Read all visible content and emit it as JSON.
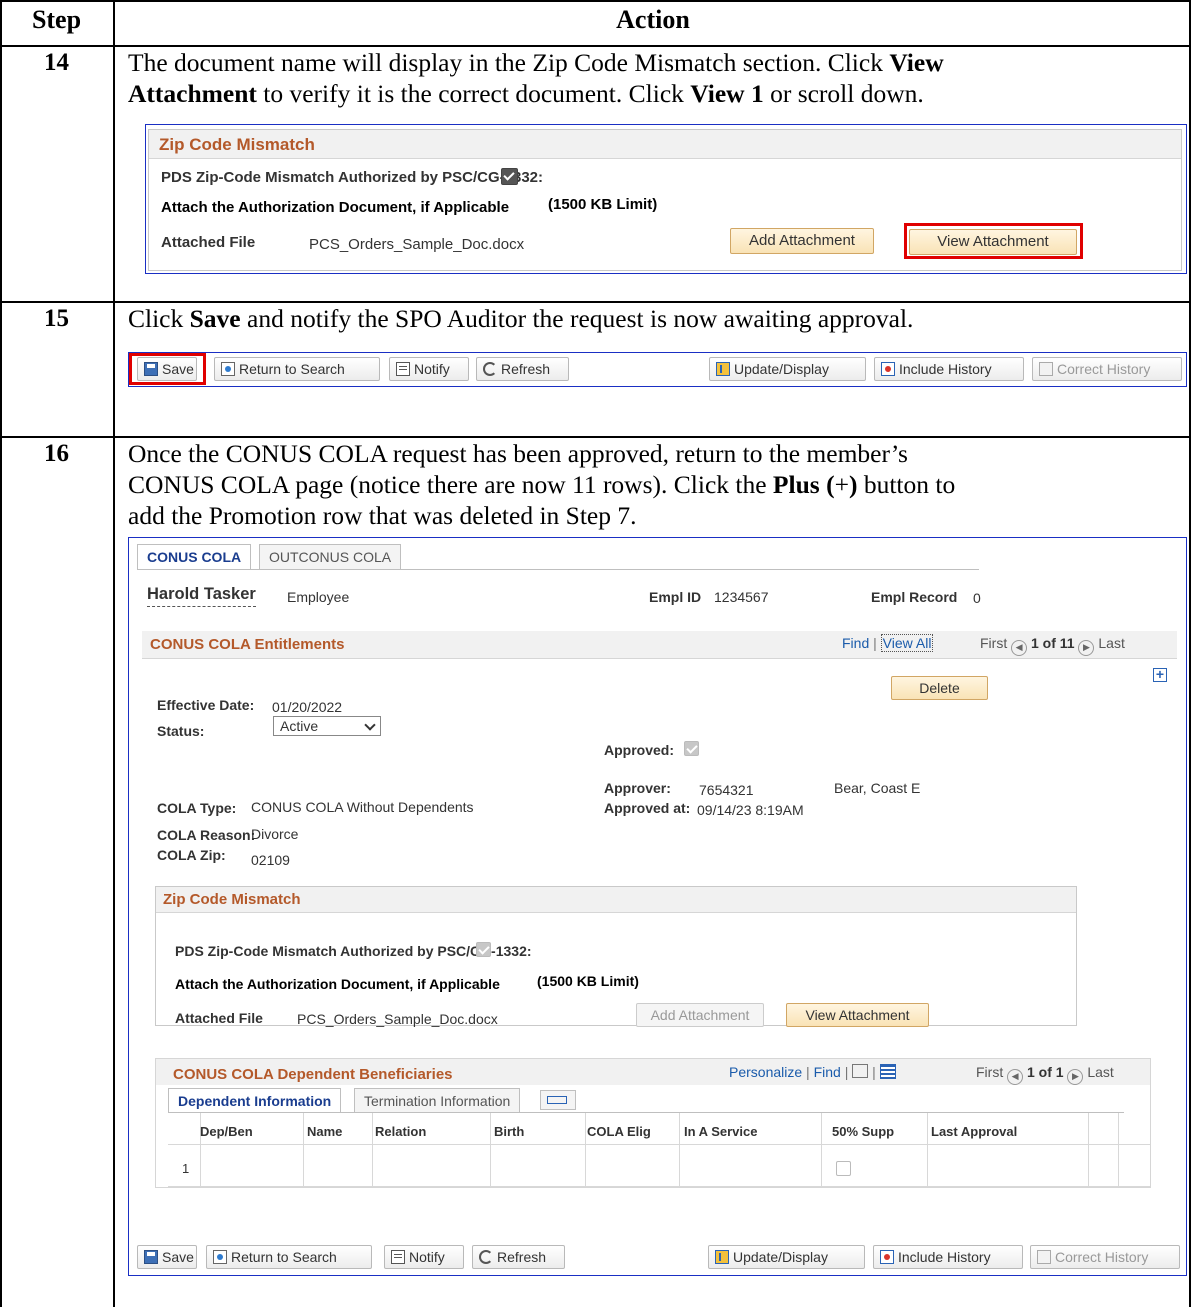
{
  "table": {
    "col_step": "Step",
    "col_action": "Action"
  },
  "steps": [
    {
      "num": "14",
      "line1_pre": "The document name will display in the Zip Code Mismatch section. Click ",
      "line1_bold": "View",
      "line2_bold": "Attachment",
      "line2_mid": " to verify it is the correct document. Click ",
      "line2_bold2": "View 1",
      "line2_post": " or scroll down."
    },
    {
      "num": "15",
      "pre": "Click ",
      "bold": "Save",
      "post": " and notify the SPO Auditor the request is now awaiting approval."
    },
    {
      "num": "16",
      "line1": "Once the CONUS COLA request has been approved, return to the member’s",
      "line2_pre": "CONUS COLA page (notice there are now 11 rows).  Click the ",
      "line2_bold": "Plus (",
      "line2_mid": "+",
      "line2_bold2": ")",
      "line2_post": " button to",
      "line3": "add the Promotion row that was deleted in Step 7."
    }
  ],
  "zip_section": {
    "title": "Zip Code Mismatch",
    "authorized_label": "PDS Zip-Code Mismatch Authorized by PSC/CG-1332:",
    "attach_label": "Attach the Authorization Document, if Applicable",
    "limit": "(1500 KB Limit)",
    "file_label": "Attached File",
    "file_name": "PCS_Orders_Sample_Doc.docx",
    "add_btn": "Add Attachment",
    "view_btn": "View Attachment"
  },
  "toolbar": {
    "save": "Save",
    "return": "Return to Search",
    "notify": "Notify",
    "refresh": "Refresh",
    "update": "Update/Display",
    "include": "Include History",
    "correct": "Correct History"
  },
  "page": {
    "tabs": [
      "CONUS COLA",
      "OUTCONUS COLA"
    ],
    "name": "Harold Tasker",
    "role": "Employee",
    "emplid_label": "Empl ID",
    "emplid": "1234567",
    "emplrec_label": "Empl Record",
    "emplrec": "0",
    "ent_title": "CONUS COLA Entitlements",
    "find": "Find",
    "view_all": "View All",
    "first": "First",
    "pager": "1 of 11",
    "last": "Last",
    "delete_btn": "Delete",
    "eff_label": "Effective Date:",
    "eff_val": "01/20/2022",
    "status_label": "Status:",
    "status_val": "Active",
    "approved_label": "Approved:",
    "approver_label": "Approver:",
    "approver_id": "7654321",
    "approver_name": "Bear, Coast E",
    "approved_at_label": "Approved at:",
    "approved_at": "09/14/23  8:19AM",
    "cola_type_label": "COLA Type:",
    "cola_type": "CONUS COLA Without Dependents",
    "cola_reason_label": "COLA Reason:",
    "cola_reason": "Divorce",
    "cola_zip_label": "COLA Zip:",
    "cola_zip": "02109"
  },
  "dependents": {
    "title": "CONUS COLA Dependent Beneficiaries",
    "personalize": "Personalize",
    "find": "Find",
    "first": "First",
    "pager": "1 of 1",
    "last": "Last",
    "tab1": "Dependent Information",
    "tab2": "Termination Information",
    "columns": [
      "Dep/Ben",
      "Name",
      "Relation",
      "Birth",
      "COLA Elig",
      "In A Service",
      "50% Supp",
      "Last Approval"
    ],
    "row_num": "1"
  }
}
